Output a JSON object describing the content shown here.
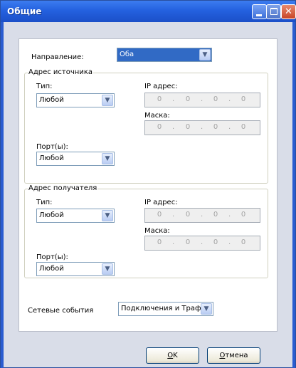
{
  "window": {
    "title": "Общие"
  },
  "direction": {
    "label": "Направление:",
    "value": "Оба"
  },
  "source": {
    "legend": "Адрес источника",
    "type_label": "Тип:",
    "type_value": "Любой",
    "ip_label": "IP адрес:",
    "ip_octets": [
      "0",
      "0",
      "0",
      "0"
    ],
    "mask_label": "Маска:",
    "mask_octets": [
      "0",
      "0",
      "0",
      "0"
    ],
    "ports_label": "Порт(ы):",
    "ports_value": "Любой"
  },
  "destination": {
    "legend": "Адрес получателя",
    "type_label": "Тип:",
    "type_value": "Любой",
    "ip_label": "IP адрес:",
    "ip_octets": [
      "0",
      "0",
      "0",
      "0"
    ],
    "mask_label": "Маска:",
    "mask_octets": [
      "0",
      "0",
      "0",
      "0"
    ],
    "ports_label": "Порт(ы):",
    "ports_value": "Любой"
  },
  "events": {
    "label": "Сетевые события",
    "value": "Подключения и Трафик"
  },
  "buttons": {
    "ok_mnemonic": "O",
    "ok_rest": "K",
    "cancel_mnemonic": "О",
    "cancel_rest": "тмена"
  },
  "icons": {
    "dropdown": "chevron-down-icon",
    "minimize": "minimize-icon",
    "maximize": "maximize-icon",
    "close": "close-icon"
  }
}
